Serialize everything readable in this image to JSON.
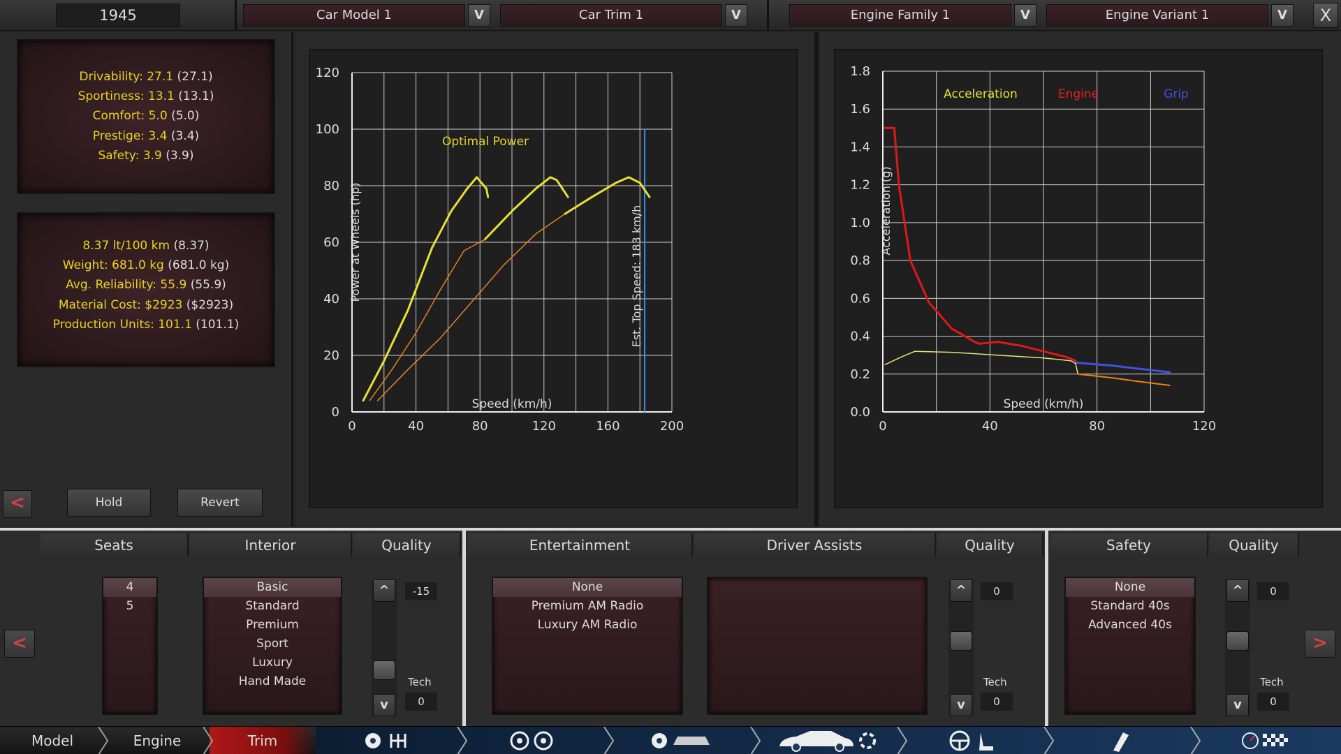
{
  "top": {
    "year": "1945",
    "dropdowns": [
      {
        "name": "car-model",
        "value": "Car Model 1"
      },
      {
        "name": "car-trim",
        "value": "Car Trim 1"
      },
      {
        "name": "engine-family",
        "value": "Engine Family 1"
      },
      {
        "name": "engine-variant",
        "value": "Engine Variant 1"
      }
    ],
    "dropdown_button": "V",
    "close_label": "X"
  },
  "stats1": [
    {
      "label": "Drivability: 27.1",
      "paren": "(27.1)"
    },
    {
      "label": "Sportiness: 13.1",
      "paren": "(13.1)"
    },
    {
      "label": "Comfort: 5.0",
      "paren": "(5.0)"
    },
    {
      "label": "Prestige: 3.4",
      "paren": "(3.4)"
    },
    {
      "label": "Safety: 3.9",
      "paren": "(3.9)"
    }
  ],
  "stats2": [
    {
      "label": "8.37 lt/100 km",
      "paren": "(8.37)"
    },
    {
      "label": "Weight: 681.0 kg",
      "paren": "(681.0 kg)"
    },
    {
      "label": "Avg. Reliability: 55.9",
      "paren": "(55.9)"
    },
    {
      "label": "Material Cost: $2923",
      "paren": "($2923)"
    },
    {
      "label": "Production Units: 101.1",
      "paren": "(101.1)"
    }
  ],
  "left_buttons": {
    "back": "<",
    "hold": "Hold",
    "revert": "Revert"
  },
  "chart_data": [
    {
      "type": "line",
      "title": "Optimal Power",
      "xlabel": "Speed (km/h)",
      "ylabel": "Power at Wheels (hp)",
      "xlim": [
        0,
        200
      ],
      "ylim": [
        0,
        120
      ],
      "xticks": [
        "0",
        "40",
        "80",
        "120",
        "160",
        "200"
      ],
      "yticks": [
        "0",
        "20",
        "40",
        "60",
        "80",
        "100",
        "120"
      ],
      "grid": true,
      "annotation": {
        "label": "Est. Top Speed: 183 km/h",
        "x": 183
      },
      "series": [
        {
          "color": "#e8e030",
          "width": 3,
          "points": [
            [
              7,
              4
            ],
            [
              20,
              18
            ],
            [
              35,
              36
            ],
            [
              50,
              58
            ],
            [
              62,
              71
            ],
            [
              72,
              79
            ],
            [
              78,
              83
            ],
            [
              84,
              79
            ],
            [
              85,
              76
            ]
          ]
        },
        {
          "color": "#e8e030",
          "width": 3,
          "points": [
            [
              83,
              61
            ],
            [
              100,
              71
            ],
            [
              115,
              79
            ],
            [
              124,
              83
            ],
            [
              128,
              82
            ],
            [
              135,
              76
            ]
          ]
        },
        {
          "color": "#e8e030",
          "width": 3,
          "points": [
            [
              133,
              70
            ],
            [
              150,
              76
            ],
            [
              165,
              81
            ],
            [
              173,
              83
            ],
            [
              180,
              81
            ],
            [
              186,
              76
            ]
          ]
        },
        {
          "color": "#e88020",
          "width": 1.5,
          "points": [
            [
              11,
              4
            ],
            [
              25,
              15
            ],
            [
              40,
              28
            ],
            [
              55,
              43
            ],
            [
              70,
              57
            ],
            [
              83,
              61
            ]
          ]
        },
        {
          "color": "#e88020",
          "width": 1.5,
          "points": [
            [
              16,
              4
            ],
            [
              35,
              15
            ],
            [
              55,
              26
            ],
            [
              75,
              39
            ],
            [
              95,
              52
            ],
            [
              115,
              63
            ],
            [
              133,
              70
            ]
          ]
        }
      ]
    },
    {
      "type": "line",
      "xlabel": "Speed (km/h)",
      "ylabel": "Acceleration (g)",
      "xlim": [
        0,
        140
      ],
      "ylim": [
        0.0,
        1.8
      ],
      "xticks": [
        "0",
        "40",
        "80",
        "120"
      ],
      "yticks": [
        "0.0",
        "0.2",
        "0.4",
        "0.6",
        "0.8",
        "1.0",
        "1.2",
        "1.4",
        "1.6",
        "1.8"
      ],
      "grid": true,
      "legend": [
        {
          "name": "Acceleration",
          "color": "#e8e030"
        },
        {
          "name": "Engine",
          "color": "#e82020"
        },
        {
          "name": "Grip",
          "color": "#4050e0"
        }
      ],
      "series": [
        {
          "name": "Engine",
          "color": "#e01818",
          "width": 3,
          "points": [
            [
              1,
              1.5
            ],
            [
              5,
              1.5
            ],
            [
              7,
              1.2
            ],
            [
              12,
              0.8
            ],
            [
              20,
              0.58
            ],
            [
              30,
              0.44
            ],
            [
              40,
              0.37
            ],
            [
              42,
              0.36
            ],
            [
              50,
              0.37
            ],
            [
              60,
              0.35
            ],
            [
              70,
              0.32
            ],
            [
              80,
              0.29
            ],
            [
              84,
              0.27
            ]
          ]
        },
        {
          "name": "Grip",
          "color": "#4050e0",
          "width": 3,
          "points": [
            [
              84,
              0.26
            ],
            [
              100,
              0.245
            ],
            [
              110,
              0.23
            ],
            [
              125,
              0.21
            ]
          ]
        },
        {
          "name": "Acceleration",
          "color": "#e8e080",
          "width": 1.5,
          "points": [
            [
              1,
              0.25
            ],
            [
              8,
              0.29
            ],
            [
              14,
              0.32
            ],
            [
              30,
              0.315
            ],
            [
              50,
              0.3
            ],
            [
              70,
              0.285
            ],
            [
              82,
              0.27
            ],
            [
              84,
              0.255
            ],
            [
              85,
              0.2
            ]
          ]
        },
        {
          "name": "Acceleration-orange",
          "color": "#f08010",
          "width": 2,
          "points": [
            [
              85,
              0.2
            ],
            [
              100,
              0.18
            ],
            [
              112,
              0.16
            ],
            [
              125,
              0.14
            ]
          ]
        }
      ]
    }
  ],
  "parts": {
    "seats": {
      "header": "Seats",
      "items": [
        "4",
        "5"
      ],
      "selected": 0
    },
    "interior": {
      "header": "Interior",
      "items": [
        "Basic",
        "Standard",
        "Premium",
        "Sport",
        "Luxury",
        "Hand Made"
      ],
      "selected": 0
    },
    "quality1": {
      "header": "Quality",
      "value": "-15",
      "tech_label": "Tech",
      "tech": "0",
      "up": "^",
      "down": "v"
    },
    "entertainment": {
      "header": "Entertainment",
      "items": [
        "None",
        "Premium AM Radio",
        "Luxury AM Radio"
      ],
      "selected": 0
    },
    "driver_assists": {
      "header": "Driver Assists",
      "items": []
    },
    "quality2": {
      "header": "Quality",
      "value": "0",
      "tech_label": "Tech",
      "tech": "0",
      "up": "^",
      "down": "v"
    },
    "safety": {
      "header": "Safety",
      "items": [
        "None",
        "Standard 40s",
        "Advanced 40s"
      ],
      "selected": 0
    },
    "quality3": {
      "header": "Quality",
      "value": "0",
      "tech_label": "Tech",
      "tech": "0",
      "up": "^",
      "down": "v"
    },
    "prev": "<",
    "next": ">"
  },
  "nav": {
    "items": [
      {
        "name": "Model",
        "active": false
      },
      {
        "name": "Engine",
        "active": false
      },
      {
        "name": "Trim",
        "active": true
      }
    ],
    "icons": [
      "gearbox-icon",
      "wheels-icon",
      "chassis-icon",
      "body-icon",
      "interior-icon",
      "tuning-icon",
      "testing-icon"
    ]
  }
}
